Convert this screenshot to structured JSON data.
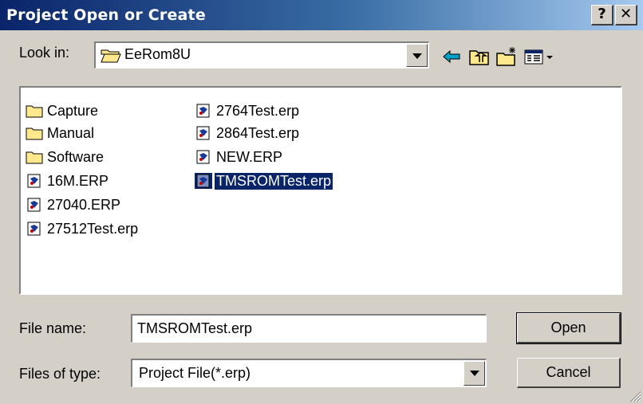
{
  "window": {
    "title": "Project Open or Create",
    "help_label": "?",
    "close_label": "✕"
  },
  "lookin": {
    "label": "Look in:",
    "value": "EeRom8U"
  },
  "toolbar": {
    "icons": [
      "back-arrow-icon",
      "up-folder-icon",
      "new-folder-icon",
      "view-menu-icon"
    ]
  },
  "files": [
    {
      "name": "Capture",
      "type": "folder"
    },
    {
      "name": "Manual",
      "type": "folder"
    },
    {
      "name": "Software",
      "type": "folder"
    },
    {
      "name": "16M.ERP",
      "type": "file"
    },
    {
      "name": "27040.ERP",
      "type": "file"
    },
    {
      "name": "27512Test.erp",
      "type": "file"
    },
    {
      "name": "2764Test.erp",
      "type": "file"
    },
    {
      "name": "2864Test.erp",
      "type": "file"
    },
    {
      "name": "NEW.ERP",
      "type": "file"
    },
    {
      "name": "TMSROMTest.erp",
      "type": "file",
      "selected": true
    }
  ],
  "filename": {
    "label": "File name:",
    "value": "TMSROMTest.erp"
  },
  "filetype": {
    "label": "Files of type:",
    "value": "Project File(*.erp)"
  },
  "buttons": {
    "open": "Open",
    "cancel": "Cancel"
  },
  "colors": {
    "selection": "#0a246a",
    "dialog_face": "#d4d0c8",
    "folder": "#ffe98c"
  }
}
